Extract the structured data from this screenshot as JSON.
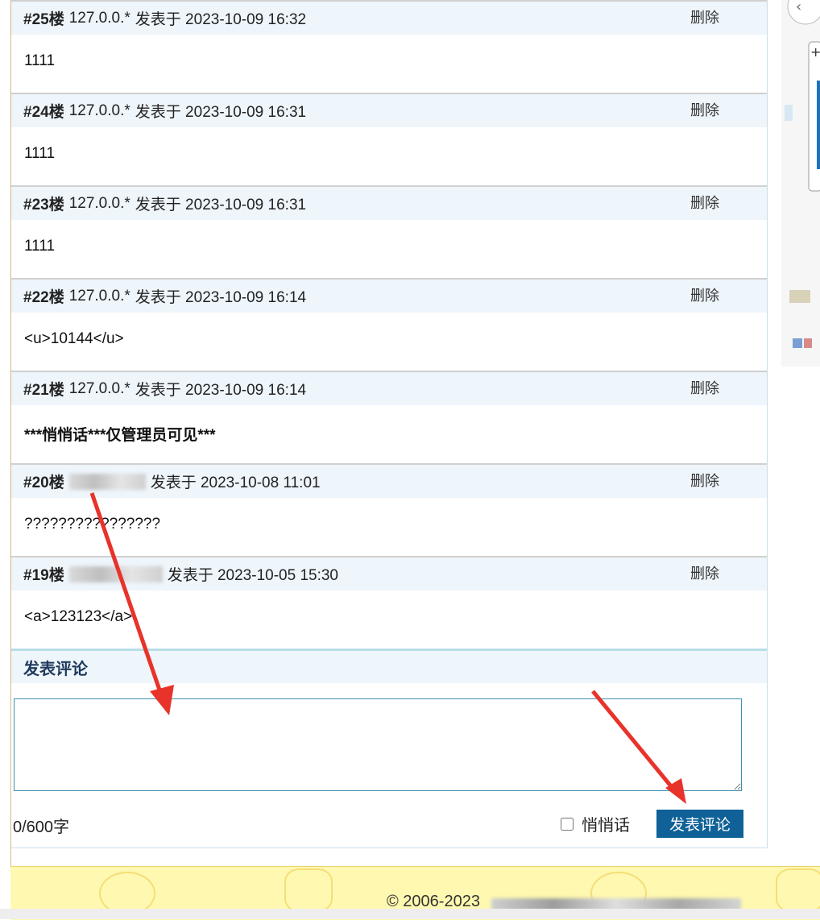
{
  "comments": [
    {
      "floor": "#25楼",
      "ip": "127.0.0.*",
      "posted": "发表于 2023-10-09 16:32",
      "delete": "删除",
      "body": "1111"
    },
    {
      "floor": "#24楼",
      "ip": "127.0.0.*",
      "posted": "发表于 2023-10-09 16:31",
      "delete": "删除",
      "body": "1111"
    },
    {
      "floor": "#23楼",
      "ip": "127.0.0.*",
      "posted": "发表于 2023-10-09 16:31",
      "delete": "删除",
      "body": "1111"
    },
    {
      "floor": "#22楼",
      "ip": "127.0.0.*",
      "posted": "发表于 2023-10-09 16:14",
      "delete": "删除",
      "body": "<u>10144</u>"
    },
    {
      "floor": "#21楼",
      "ip": "127.0.0.*",
      "posted": "发表于 2023-10-09 16:14",
      "delete": "删除",
      "body": "***悄悄话***仅管理员可见***"
    },
    {
      "floor": "#20楼",
      "ip": "",
      "posted": "发表于 2023-10-08 11:01",
      "delete": "删除",
      "body": "????????????????"
    },
    {
      "floor": "#19楼",
      "ip": "",
      "posted": "发表于 2023-10-05 15:30",
      "delete": "删除",
      "body": "<a>123123</a>"
    }
  ],
  "form": {
    "title": "发表评论",
    "counter": "0/600字",
    "whisper_label": "悄悄话",
    "submit_label": "发表评论"
  },
  "footer": {
    "copyright": "© 2006-2023"
  },
  "colors": {
    "header_bg": "#eef5fb",
    "submit": "#0f6197",
    "footer_bg": "#fff8b0",
    "annotation_arrow": "#e8332a"
  }
}
